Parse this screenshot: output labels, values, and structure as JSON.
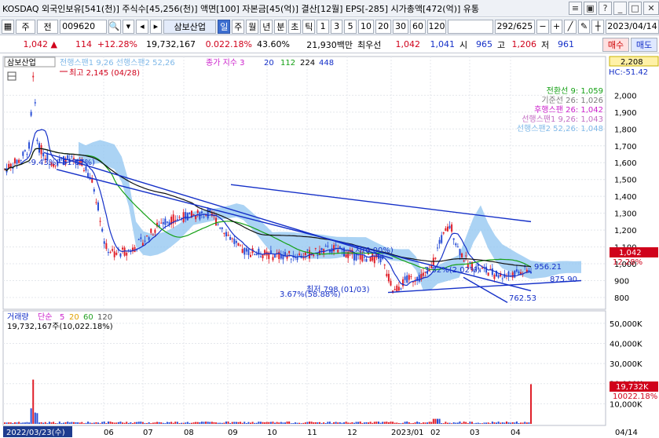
{
  "window": {
    "title": "KOSDAQ 외국인보유[541(천)] 주식수[45,256(천)] 액면[100] 자본금[45(억)] 결산[12월] EPS[-285] 시가총액[472(억)] 유통",
    "buttons": [
      "≡",
      "▣",
      "?",
      "_",
      "□",
      "✕"
    ]
  },
  "toolbar": {
    "chart_type": "주",
    "mode": "전",
    "code": "009620",
    "stock_name": "삼보산업",
    "periods": [
      "일",
      "주",
      "월",
      "년",
      "분",
      "초",
      "틱"
    ],
    "selected_period": "일",
    "intervals": [
      "1",
      "3",
      "5",
      "10",
      "20",
      "30",
      "60",
      "120"
    ],
    "count": "292",
    "total": "625",
    "date": "2023/04/14"
  },
  "quote": {
    "price": "1,042",
    "arrow": "▲",
    "change": "114",
    "change_pct": "+12.28%",
    "volume": "19,732,167",
    "volume_ratio": "0.022.18%",
    "turnover": "43.60%",
    "amount": "21,930백만",
    "best_label": "최우선",
    "best_bid": "1,042",
    "best_ask": "1,041",
    "open_label": "시",
    "open": "965",
    "high_label": "고",
    "high": "1,206",
    "low_label": "저",
    "low": "961",
    "buy_label": "매수",
    "sell_label": "매도"
  },
  "chart_labels": {
    "stock_tab": "삼보산업",
    "overlay_header": "전행스팬1 9,26 선행스팬2 52,26",
    "ma_header": "종가 지수 3",
    "ma_periods": [
      "20",
      "112",
      "224",
      "448"
    ],
    "top_price_box": "2,208",
    "hc_label": "HC:-51.42",
    "high_annotation": "최고 2,145 (04/28)",
    "low_annotation": "최저 798 (01/03)",
    "pct_annotation_1": "-9.43%(-51.67%)",
    "pct_annotation_2": "3.67%(58.88%)",
    "pct_annotation_3": "3.52%(2.02%)",
    "trend_label": "지(0.00%)",
    "trend_value_1": "956.21",
    "trend_value_2": "875.90",
    "trend_value_3": "762.53",
    "current_price_box": "1,042",
    "current_pct_box": "12.28%",
    "ichimoku_legend": [
      {
        "text": "전환선 9: 1,059",
        "color": "#14a014"
      },
      {
        "text": "기준선 26: 1,026",
        "color": "#7a7a7a"
      },
      {
        "text": "후행스팬 26: 1,042",
        "color": "#cc22cc"
      },
      {
        "text": "선행스팬1 9,26: 1,043",
        "color": "#c36ec3"
      },
      {
        "text": "선행스팬2 52,26: 1,048",
        "color": "#7fb8e8"
      }
    ],
    "volume_header": "거래량",
    "volume_mode": "단순",
    "volume_ma": [
      {
        "text": "5",
        "color": "#cc22cc"
      },
      {
        "text": "20",
        "color": "#e0a000"
      },
      {
        "text": "60",
        "color": "#22a022"
      },
      {
        "text": "120",
        "color": "#555555"
      }
    ],
    "volume_value": "19,732,167주(10,022.18%)",
    "volume_box": "19,732K",
    "volume_pct_box": "10022.18%",
    "start_date": "2022/03/23(수)",
    "end_date": "04/14",
    "month_labels": [
      "06",
      "07",
      "08",
      "09",
      "10",
      "11",
      "12",
      "2023/01",
      "02",
      "03",
      "04"
    ]
  },
  "chart_data": {
    "type": "candlestick",
    "y_ticks": [
      "2,000",
      "1,900",
      "1,800",
      "1,700",
      "1,600",
      "1,500",
      "1,400",
      "1,300",
      "1,200",
      "1,100",
      "1,000",
      "900",
      "800"
    ],
    "volume_ticks": [
      "50,000K",
      "40,000K",
      "30,000K",
      "20,000K",
      "10,000K"
    ],
    "ylim": [
      730,
      2230
    ],
    "high": 2145,
    "low": 798,
    "last_close": 1042,
    "last_volume": 19732167
  }
}
